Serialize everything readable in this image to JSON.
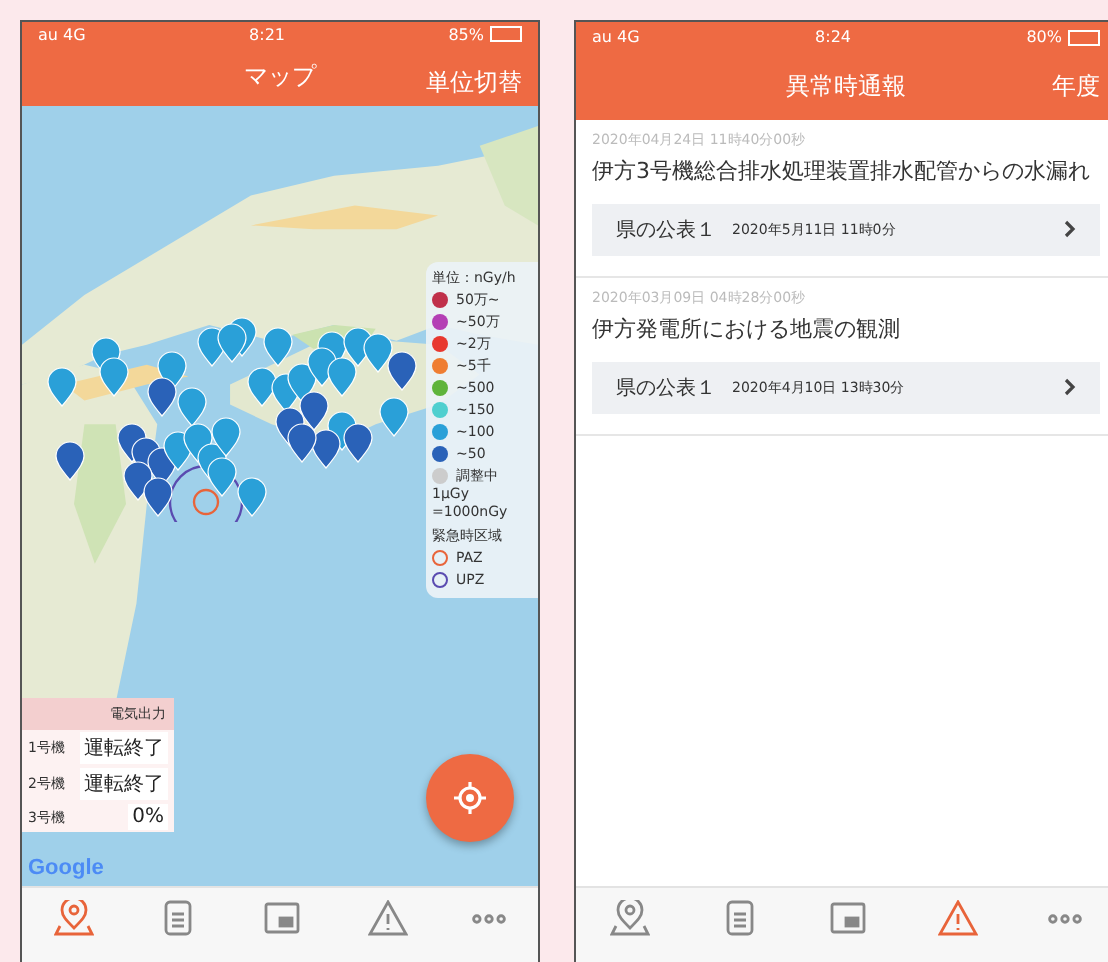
{
  "screens": [
    {
      "kind": "map",
      "status": {
        "carrier": "au 4G",
        "time": "8:21",
        "battery": "85%"
      },
      "header": {
        "title": "マップ",
        "action": "単位切替"
      },
      "legend": {
        "unit": "単位：nGy/h",
        "items": [
          {
            "label": "50万~",
            "color": "#c0304a"
          },
          {
            "label": "~50万",
            "color": "#b43fb5"
          },
          {
            "label": "~2万",
            "color": "#e8382f"
          },
          {
            "label": "~5千",
            "color": "#ef7d31"
          },
          {
            "label": "~500",
            "color": "#5fb43a"
          },
          {
            "label": "~150",
            "color": "#4fcfcf"
          },
          {
            "label": "~100",
            "color": "#2aa0d8"
          },
          {
            "label": "~50",
            "color": "#2a62b8"
          },
          {
            "label": "調整中",
            "color": "#cccccc"
          }
        ],
        "note": [
          "1μGy",
          "=1000nGy"
        ],
        "zone_title": "緊急時区域",
        "zones": [
          {
            "label": "PAZ",
            "color": "#e8643a"
          },
          {
            "label": "UPZ",
            "color": "#5a4bb0"
          }
        ]
      },
      "power": {
        "title": "電気出力",
        "rows": [
          {
            "unit": "1号機",
            "value": "運転終了"
          },
          {
            "unit": "2号機",
            "value": "運転終了"
          },
          {
            "unit": "3号機",
            "value": "0%"
          }
        ]
      },
      "attribution": "Google",
      "tabs": [
        {
          "selected": true
        },
        {
          "selected": false
        },
        {
          "selected": false
        },
        {
          "selected": false
        },
        {
          "selected": false
        }
      ]
    },
    {
      "kind": "list",
      "status": {
        "carrier": "au 4G",
        "time": "8:24",
        "battery": "80%"
      },
      "header": {
        "title": "異常時通報",
        "action": "年度"
      },
      "reports": [
        {
          "date": "2020年04月24日 11時40分00秒",
          "title": "伊方3号機総合排水処理装置排水配管からの水漏れ",
          "link": {
            "label": "県の公表１",
            "date": "2020年5月11日 11時0分"
          }
        },
        {
          "date": "2020年03月09日 04時28分00秒",
          "title": "伊方発電所における地震の観測",
          "link": {
            "label": "県の公表１",
            "date": "2020年4月10日 13時30分"
          }
        }
      ],
      "tabs": [
        {
          "selected": false
        },
        {
          "selected": false
        },
        {
          "selected": false
        },
        {
          "selected": true
        },
        {
          "selected": false
        }
      ]
    }
  ]
}
